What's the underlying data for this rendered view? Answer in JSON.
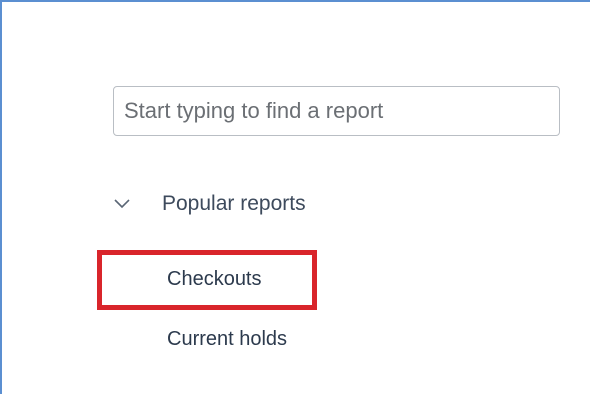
{
  "search": {
    "placeholder": "Start typing to find a report"
  },
  "section": {
    "label": "Popular reports",
    "icon": "chevron-down-icon",
    "expanded": true
  },
  "reports": [
    {
      "label": "Checkouts",
      "highlighted": true
    },
    {
      "label": "Current holds",
      "highlighted": false
    }
  ],
  "colors": {
    "highlight": "#d9252b",
    "frame": "#5b8fd1"
  }
}
